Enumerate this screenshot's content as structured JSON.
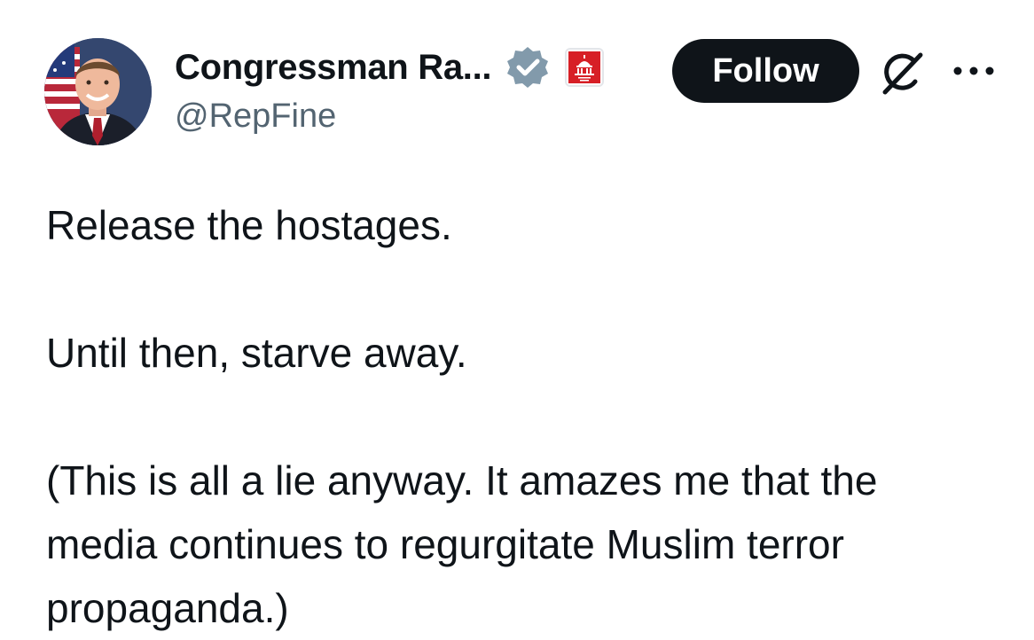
{
  "author": {
    "display_name": "Congressman Ra...",
    "handle": "@RepFine",
    "avatar_icon": "profile-photo",
    "verified_icon": "verified-badge-icon",
    "verified_color": "#829aab",
    "affiliation_icon": "house-gop-capitol-icon",
    "affiliation_color": "#d71f26"
  },
  "actions": {
    "follow_label": "Follow",
    "grok_icon": "grok-icon",
    "more_icon": "more-options-icon"
  },
  "tweet": {
    "lines": [
      "Release the hostages.",
      "Until then, starve away.",
      "(This is all a lie anyway.  It amazes me that the",
      "media continues to regurgitate Muslim terror",
      "propaganda.)"
    ]
  }
}
